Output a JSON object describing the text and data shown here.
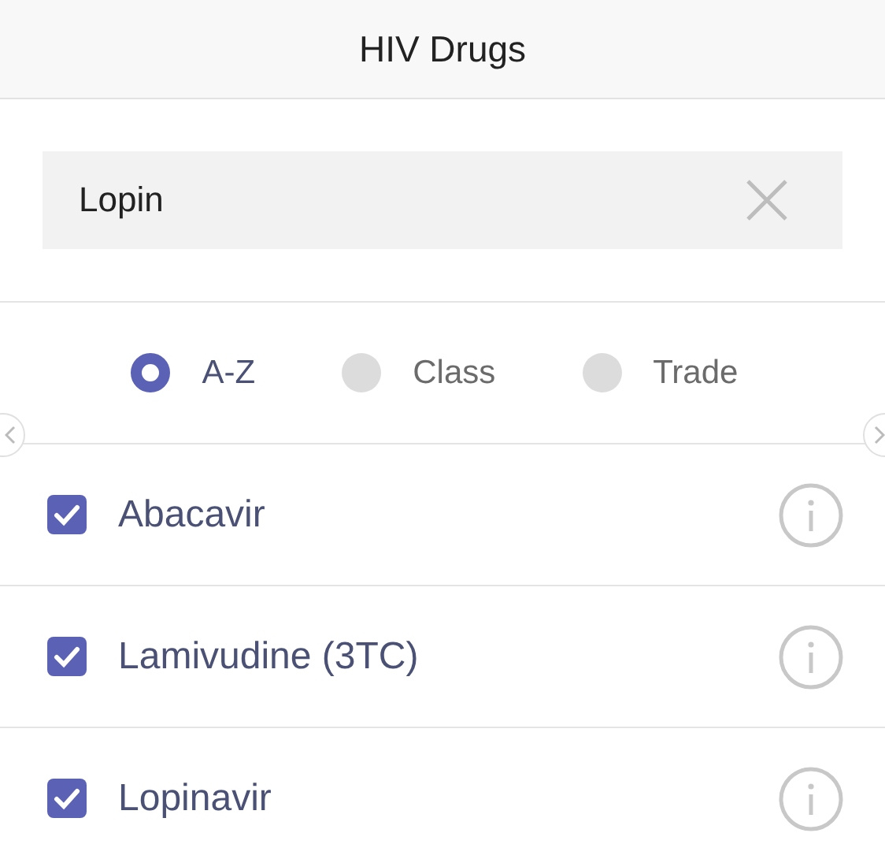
{
  "header": {
    "title": "HIV Drugs"
  },
  "search": {
    "value": "Lopin"
  },
  "sort_options": [
    {
      "label": "A-Z",
      "selected": true
    },
    {
      "label": "Class",
      "selected": false
    },
    {
      "label": "Trade",
      "selected": false
    }
  ],
  "drugs": [
    {
      "name": "Abacavir",
      "checked": true
    },
    {
      "name": "Lamivudine (3TC)",
      "checked": true
    },
    {
      "name": "Lopinavir",
      "checked": true
    }
  ]
}
